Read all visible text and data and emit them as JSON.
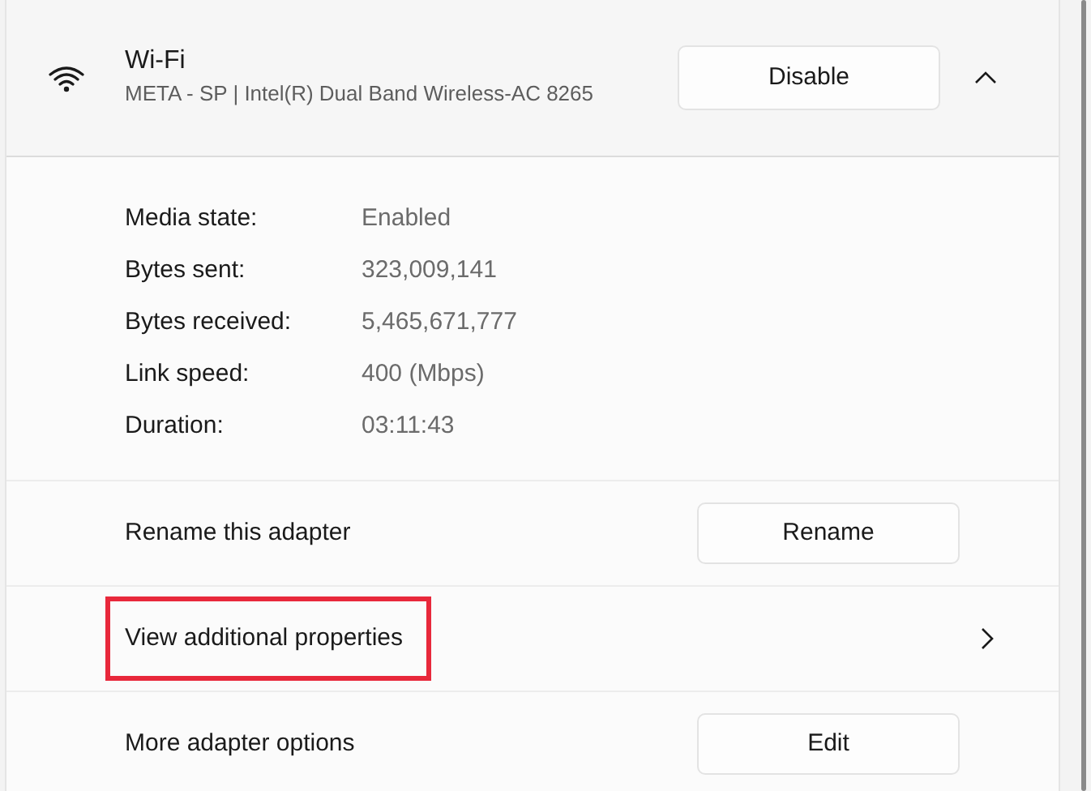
{
  "adapter": {
    "name": "Wi-Fi",
    "description": "META - SP | Intel(R) Dual Band Wireless-AC 8265",
    "button": "Disable",
    "expanded": true
  },
  "details": [
    {
      "label": "Media state:",
      "value": "Enabled"
    },
    {
      "label": "Bytes sent:",
      "value": "323,009,141"
    },
    {
      "label": "Bytes received:",
      "value": "5,465,671,777"
    },
    {
      "label": "Link speed:",
      "value": "400 (Mbps)"
    },
    {
      "label": "Duration:",
      "value": "03:11:43"
    }
  ],
  "actions": [
    {
      "kind": "button",
      "label": "Rename this adapter",
      "button": "Rename",
      "highlighted": false
    },
    {
      "kind": "link",
      "label": "View additional properties",
      "highlighted": true
    },
    {
      "kind": "button",
      "label": "More adapter options",
      "button": "Edit",
      "highlighted": false
    }
  ]
}
